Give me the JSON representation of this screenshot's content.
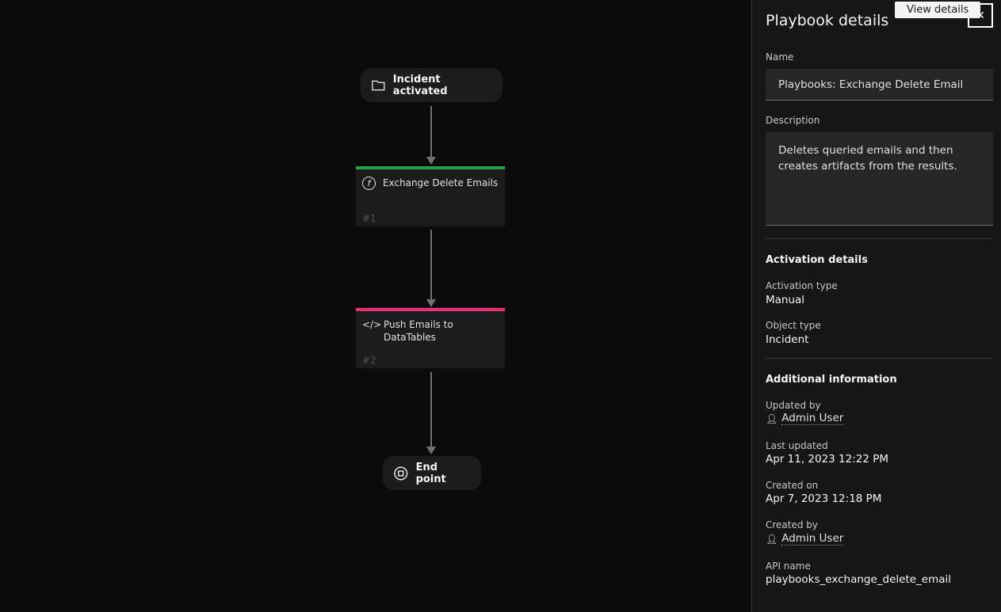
{
  "canvas": {
    "start": {
      "label": "Incident activated",
      "icon": "folder-icon"
    },
    "nodes": [
      {
        "title": "Exchange Delete Emails",
        "number": "#1",
        "icon": "function-icon",
        "color": "#24a148"
      },
      {
        "title": "Push Emails to DataTables",
        "number": "#2",
        "icon": "code-icon",
        "color": "#ee2f75"
      }
    ],
    "end": {
      "label": "End point",
      "icon": "stop-icon"
    }
  },
  "panel": {
    "title": "Playbook details",
    "tooltip": "View details",
    "close_icon": "close-icon",
    "name_label": "Name",
    "name_value": "Playbooks: Exchange Delete Email",
    "description_label": "Description",
    "description_value": "Deletes queried emails and then creates artifacts from the results.",
    "activation": {
      "heading": "Activation details",
      "type_label": "Activation type",
      "type_value": "Manual",
      "object_label": "Object type",
      "object_value": "Incident"
    },
    "additional": {
      "heading": "Additional information",
      "updated_by_label": "Updated by",
      "updated_by": "Admin User",
      "last_updated_label": "Last updated",
      "last_updated": "Apr 11, 2023 12:22 PM",
      "created_on_label": "Created on",
      "created_on": "Apr 7, 2023 12:18 PM",
      "created_by_label": "Created by",
      "created_by": "Admin User",
      "api_label": "API name",
      "api_value": "playbooks_exchange_delete_email"
    }
  }
}
